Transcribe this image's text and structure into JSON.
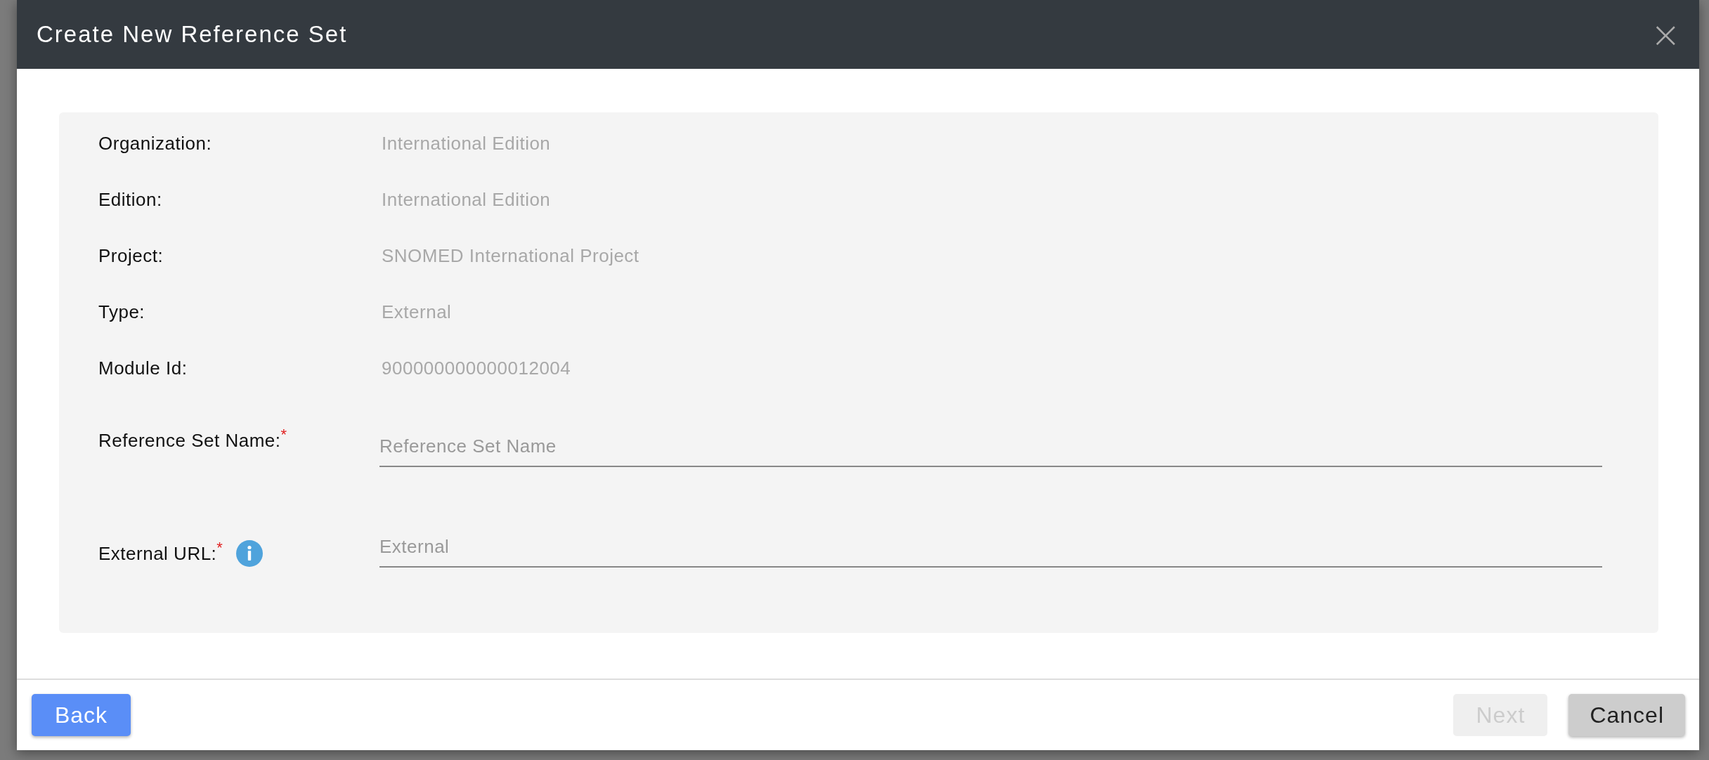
{
  "dialog": {
    "title": "Create New Reference Set",
    "close": "×"
  },
  "details": [
    {
      "label": "Organization:",
      "value": "International Edition"
    },
    {
      "label": "Edition:",
      "value": "International Edition"
    },
    {
      "label": "Project:",
      "value": "SNOMED International Project"
    },
    {
      "label": "Type:",
      "value": "External"
    },
    {
      "label": "Module Id:",
      "value": "900000000000012004"
    }
  ],
  "fields": [
    {
      "label": "Reference Set Name:",
      "required_mark": "*",
      "placeholder": "Reference Set Name"
    },
    {
      "label": "External URL:",
      "required_mark": "*",
      "info": true,
      "placeholder": "External"
    }
  ],
  "buttons": [
    {
      "label": "Back",
      "kind": "primary",
      "disabled": false
    },
    {
      "label": "Next",
      "kind": "secondary",
      "disabled": true
    },
    {
      "label": "Cancel",
      "kind": "secondary",
      "disabled": false
    }
  ]
}
